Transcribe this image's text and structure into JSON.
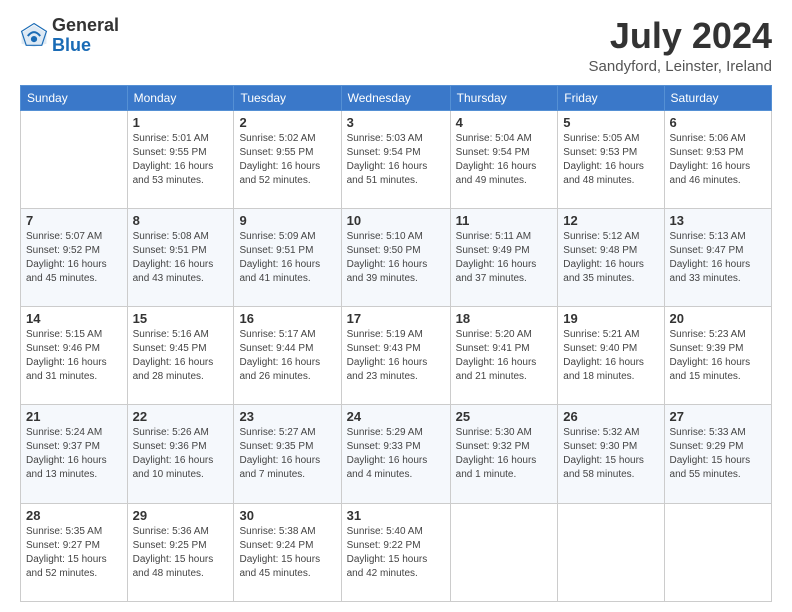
{
  "header": {
    "logo_general": "General",
    "logo_blue": "Blue",
    "title": "July 2024",
    "location": "Sandyford, Leinster, Ireland"
  },
  "days_of_week": [
    "Sunday",
    "Monday",
    "Tuesday",
    "Wednesday",
    "Thursday",
    "Friday",
    "Saturday"
  ],
  "weeks": [
    [
      {
        "day": "",
        "sunrise": "",
        "sunset": "",
        "daylight": ""
      },
      {
        "day": "1",
        "sunrise": "Sunrise: 5:01 AM",
        "sunset": "Sunset: 9:55 PM",
        "daylight": "Daylight: 16 hours and 53 minutes."
      },
      {
        "day": "2",
        "sunrise": "Sunrise: 5:02 AM",
        "sunset": "Sunset: 9:55 PM",
        "daylight": "Daylight: 16 hours and 52 minutes."
      },
      {
        "day": "3",
        "sunrise": "Sunrise: 5:03 AM",
        "sunset": "Sunset: 9:54 PM",
        "daylight": "Daylight: 16 hours and 51 minutes."
      },
      {
        "day": "4",
        "sunrise": "Sunrise: 5:04 AM",
        "sunset": "Sunset: 9:54 PM",
        "daylight": "Daylight: 16 hours and 49 minutes."
      },
      {
        "day": "5",
        "sunrise": "Sunrise: 5:05 AM",
        "sunset": "Sunset: 9:53 PM",
        "daylight": "Daylight: 16 hours and 48 minutes."
      },
      {
        "day": "6",
        "sunrise": "Sunrise: 5:06 AM",
        "sunset": "Sunset: 9:53 PM",
        "daylight": "Daylight: 16 hours and 46 minutes."
      }
    ],
    [
      {
        "day": "7",
        "sunrise": "Sunrise: 5:07 AM",
        "sunset": "Sunset: 9:52 PM",
        "daylight": "Daylight: 16 hours and 45 minutes."
      },
      {
        "day": "8",
        "sunrise": "Sunrise: 5:08 AM",
        "sunset": "Sunset: 9:51 PM",
        "daylight": "Daylight: 16 hours and 43 minutes."
      },
      {
        "day": "9",
        "sunrise": "Sunrise: 5:09 AM",
        "sunset": "Sunset: 9:51 PM",
        "daylight": "Daylight: 16 hours and 41 minutes."
      },
      {
        "day": "10",
        "sunrise": "Sunrise: 5:10 AM",
        "sunset": "Sunset: 9:50 PM",
        "daylight": "Daylight: 16 hours and 39 minutes."
      },
      {
        "day": "11",
        "sunrise": "Sunrise: 5:11 AM",
        "sunset": "Sunset: 9:49 PM",
        "daylight": "Daylight: 16 hours and 37 minutes."
      },
      {
        "day": "12",
        "sunrise": "Sunrise: 5:12 AM",
        "sunset": "Sunset: 9:48 PM",
        "daylight": "Daylight: 16 hours and 35 minutes."
      },
      {
        "day": "13",
        "sunrise": "Sunrise: 5:13 AM",
        "sunset": "Sunset: 9:47 PM",
        "daylight": "Daylight: 16 hours and 33 minutes."
      }
    ],
    [
      {
        "day": "14",
        "sunrise": "Sunrise: 5:15 AM",
        "sunset": "Sunset: 9:46 PM",
        "daylight": "Daylight: 16 hours and 31 minutes."
      },
      {
        "day": "15",
        "sunrise": "Sunrise: 5:16 AM",
        "sunset": "Sunset: 9:45 PM",
        "daylight": "Daylight: 16 hours and 28 minutes."
      },
      {
        "day": "16",
        "sunrise": "Sunrise: 5:17 AM",
        "sunset": "Sunset: 9:44 PM",
        "daylight": "Daylight: 16 hours and 26 minutes."
      },
      {
        "day": "17",
        "sunrise": "Sunrise: 5:19 AM",
        "sunset": "Sunset: 9:43 PM",
        "daylight": "Daylight: 16 hours and 23 minutes."
      },
      {
        "day": "18",
        "sunrise": "Sunrise: 5:20 AM",
        "sunset": "Sunset: 9:41 PM",
        "daylight": "Daylight: 16 hours and 21 minutes."
      },
      {
        "day": "19",
        "sunrise": "Sunrise: 5:21 AM",
        "sunset": "Sunset: 9:40 PM",
        "daylight": "Daylight: 16 hours and 18 minutes."
      },
      {
        "day": "20",
        "sunrise": "Sunrise: 5:23 AM",
        "sunset": "Sunset: 9:39 PM",
        "daylight": "Daylight: 16 hours and 15 minutes."
      }
    ],
    [
      {
        "day": "21",
        "sunrise": "Sunrise: 5:24 AM",
        "sunset": "Sunset: 9:37 PM",
        "daylight": "Daylight: 16 hours and 13 minutes."
      },
      {
        "day": "22",
        "sunrise": "Sunrise: 5:26 AM",
        "sunset": "Sunset: 9:36 PM",
        "daylight": "Daylight: 16 hours and 10 minutes."
      },
      {
        "day": "23",
        "sunrise": "Sunrise: 5:27 AM",
        "sunset": "Sunset: 9:35 PM",
        "daylight": "Daylight: 16 hours and 7 minutes."
      },
      {
        "day": "24",
        "sunrise": "Sunrise: 5:29 AM",
        "sunset": "Sunset: 9:33 PM",
        "daylight": "Daylight: 16 hours and 4 minutes."
      },
      {
        "day": "25",
        "sunrise": "Sunrise: 5:30 AM",
        "sunset": "Sunset: 9:32 PM",
        "daylight": "Daylight: 16 hours and 1 minute."
      },
      {
        "day": "26",
        "sunrise": "Sunrise: 5:32 AM",
        "sunset": "Sunset: 9:30 PM",
        "daylight": "Daylight: 15 hours and 58 minutes."
      },
      {
        "day": "27",
        "sunrise": "Sunrise: 5:33 AM",
        "sunset": "Sunset: 9:29 PM",
        "daylight": "Daylight: 15 hours and 55 minutes."
      }
    ],
    [
      {
        "day": "28",
        "sunrise": "Sunrise: 5:35 AM",
        "sunset": "Sunset: 9:27 PM",
        "daylight": "Daylight: 15 hours and 52 minutes."
      },
      {
        "day": "29",
        "sunrise": "Sunrise: 5:36 AM",
        "sunset": "Sunset: 9:25 PM",
        "daylight": "Daylight: 15 hours and 48 minutes."
      },
      {
        "day": "30",
        "sunrise": "Sunrise: 5:38 AM",
        "sunset": "Sunset: 9:24 PM",
        "daylight": "Daylight: 15 hours and 45 minutes."
      },
      {
        "day": "31",
        "sunrise": "Sunrise: 5:40 AM",
        "sunset": "Sunset: 9:22 PM",
        "daylight": "Daylight: 15 hours and 42 minutes."
      },
      {
        "day": "",
        "sunrise": "",
        "sunset": "",
        "daylight": ""
      },
      {
        "day": "",
        "sunrise": "",
        "sunset": "",
        "daylight": ""
      },
      {
        "day": "",
        "sunrise": "",
        "sunset": "",
        "daylight": ""
      }
    ]
  ]
}
